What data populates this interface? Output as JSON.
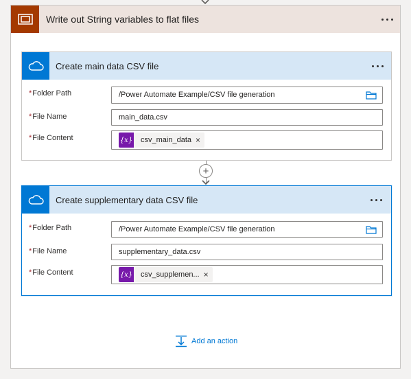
{
  "scope": {
    "title": "Write out String variables to flat files",
    "accent_color": "#a43900"
  },
  "cards": [
    {
      "title": "Create main data CSV file",
      "fields": {
        "folder_label": "Folder Path",
        "folder_value": "/Power Automate Example/CSV file generation",
        "name_label": "File Name",
        "name_value": "main_data.csv",
        "content_label": "File Content",
        "content_token": "csv_main_data"
      }
    },
    {
      "title": "Create supplementary data CSV file",
      "fields": {
        "folder_label": "Folder Path",
        "folder_value": "/Power Automate Example/CSV file generation",
        "name_label": "File Name",
        "name_value": "supplementary_data.csv",
        "content_label": "File Content",
        "content_token": "csv_supplemen..."
      }
    }
  ],
  "required_marker": "*",
  "token_icon_text": "{x}",
  "token_remove": "×",
  "plus_label": "+",
  "add_action_label": "Add an action",
  "icons": {
    "scope": "scope-icon",
    "onedrive": "onedrive-cloud-icon",
    "folder": "folder-icon",
    "variable": "variable-icon",
    "more": "more-options-icon",
    "add_action": "add-action-icon"
  },
  "colors": {
    "card_header": "#d6e7f6",
    "card_icon": "#0078d4",
    "variable_token": "#7719aa",
    "link": "#0078d4",
    "scope_header": "#ede3de"
  }
}
